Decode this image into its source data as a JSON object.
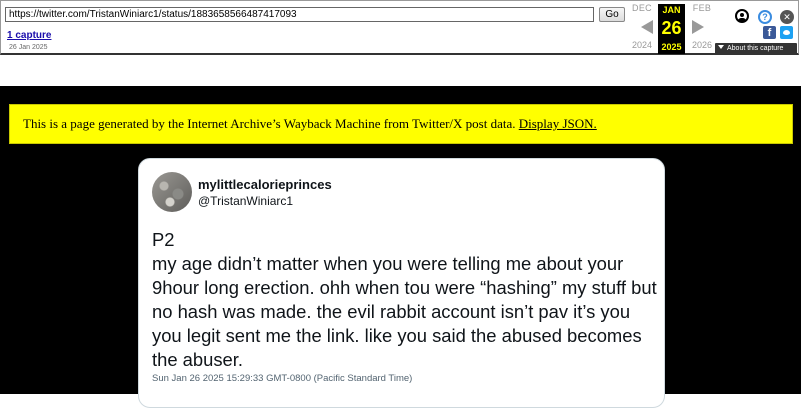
{
  "wayback": {
    "url": "https://twitter.com/TristanWiniarc1/status/1883658566487417093",
    "go_label": "Go",
    "captures_label": "1 capture",
    "captures_date": "26 Jan 2025",
    "calendar": {
      "prev_month": "DEC",
      "active_month": "JAN",
      "next_month": "FEB",
      "day": "26",
      "prev_year": "2024",
      "active_year": "2025",
      "next_year": "2026"
    },
    "help_icon_glyph": "?",
    "close_icon_glyph": "✕",
    "fb_icon_glyph": "f",
    "about_label": "About this capture"
  },
  "notice": {
    "text": "This is a page generated by the Internet Archive’s Wayback Machine from Twitter/X post data. ",
    "link_label": "Display JSON."
  },
  "tweet": {
    "display_name": "mylittlecalorieprinces",
    "handle": "@TristanWiniarc1",
    "text": "P2\nmy age didn’t matter when you were telling me about your 9hour long erection. ohh when tou were “hashing” my stuff but no hash was made. the evil rabbit account isn’t pav it’s you you legit sent me the link. like you said the abused becomes the abuser.",
    "timestamp": "Sun Jan 26 2025 15:29:33 GMT-0800 (Pacific Standard Time)"
  },
  "colors": {
    "notice_bg": "#ffff00",
    "page_bg": "#000000",
    "link": "#1a0dab",
    "wb_highlight": "#ffff00"
  },
  "icons": [
    "user-icon",
    "help-icon",
    "close-icon",
    "facebook-icon",
    "twitter-icon",
    "caret-down-icon",
    "arrow-left-icon",
    "arrow-right-icon"
  ]
}
